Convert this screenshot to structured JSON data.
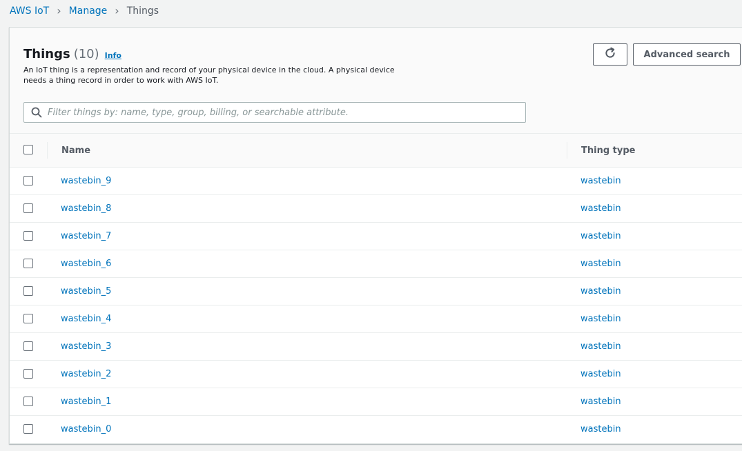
{
  "breadcrumb": {
    "items": [
      "AWS IoT",
      "Manage"
    ],
    "current": "Things"
  },
  "header": {
    "title": "Things",
    "count": "(10)",
    "info": "Info",
    "description": "An IoT thing is a representation and record of your physical device in the cloud. A physical device needs a thing record in order to work with AWS IoT.",
    "refresh_icon": "refresh-icon",
    "advanced_search_label": "Advanced search"
  },
  "search": {
    "placeholder": "Filter things by: name, type, group, billing, or searchable attribute.",
    "value": "",
    "icon": "search-icon"
  },
  "table": {
    "columns": [
      "Name",
      "Thing type"
    ],
    "rows": [
      {
        "name": "wastebin_9",
        "type": "wastebin"
      },
      {
        "name": "wastebin_8",
        "type": "wastebin"
      },
      {
        "name": "wastebin_7",
        "type": "wastebin"
      },
      {
        "name": "wastebin_6",
        "type": "wastebin"
      },
      {
        "name": "wastebin_5",
        "type": "wastebin"
      },
      {
        "name": "wastebin_4",
        "type": "wastebin"
      },
      {
        "name": "wastebin_3",
        "type": "wastebin"
      },
      {
        "name": "wastebin_2",
        "type": "wastebin"
      },
      {
        "name": "wastebin_1",
        "type": "wastebin"
      },
      {
        "name": "wastebin_0",
        "type": "wastebin"
      }
    ]
  },
  "colors": {
    "link": "#0073bb",
    "text": "#16191f",
    "border": "#eaeded",
    "background": "#f2f3f3"
  }
}
